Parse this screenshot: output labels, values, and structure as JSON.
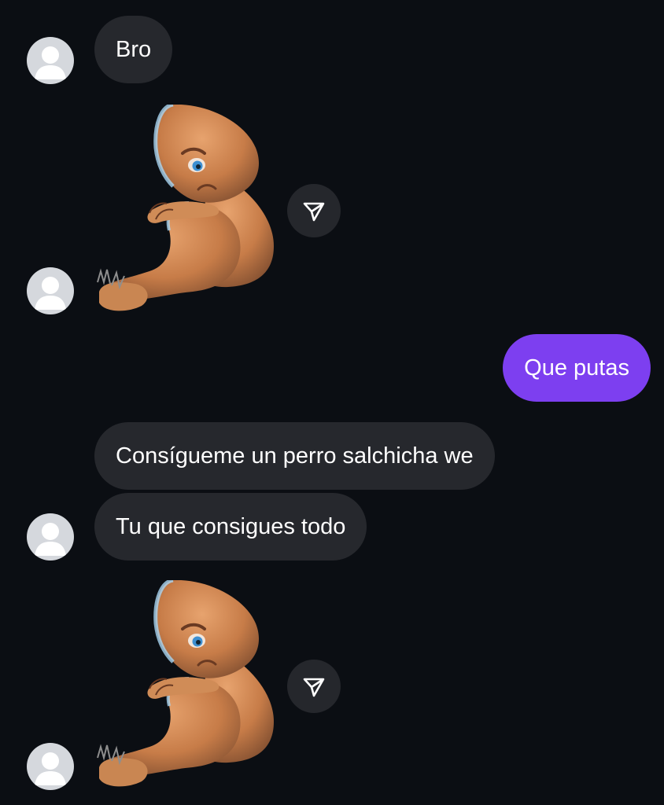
{
  "conversation": {
    "messages": [
      {
        "sender": "them",
        "text": "Bro"
      },
      {
        "sender": "them",
        "type": "sticker",
        "sticker_name": "sad-curled-up-creature-sticker"
      },
      {
        "sender": "me",
        "text": "Que putas"
      },
      {
        "sender": "them",
        "text": "Consígueme un perro salchicha we"
      },
      {
        "sender": "them",
        "text": "Tu que consigues todo"
      },
      {
        "sender": "them",
        "type": "sticker",
        "sticker_name": "sad-curled-up-creature-sticker"
      }
    ]
  },
  "icons": {
    "avatar": "default-avatar-icon",
    "share": "paper-plane-share-icon"
  },
  "colors": {
    "background": "#0b0e13",
    "received_bubble": "#26282d",
    "sent_bubble": "#7d3ff0",
    "avatar_placeholder": "#d5d8dd"
  }
}
